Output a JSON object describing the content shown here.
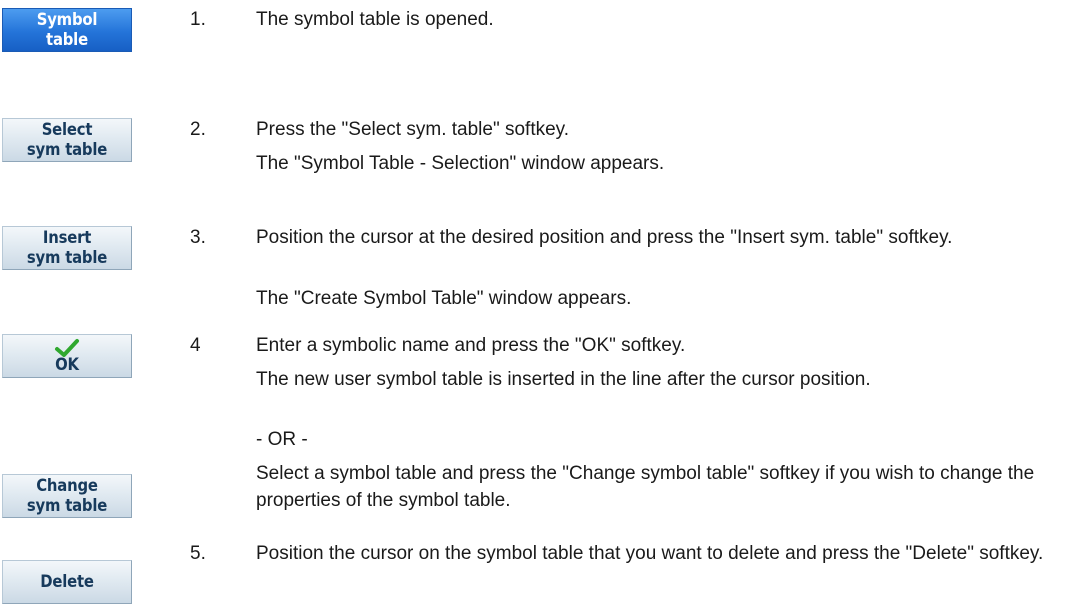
{
  "softkeys": {
    "symbol_table": [
      "Symbol",
      "table"
    ],
    "select_sym_table": [
      "Select",
      "sym table"
    ],
    "insert_sym_table": [
      "Insert",
      "sym table"
    ],
    "ok": "OK",
    "change_sym_table": [
      "Change",
      "sym table"
    ],
    "delete": "Delete"
  },
  "steps": [
    {
      "number": "1.",
      "lines": [
        "The symbol table is opened."
      ]
    },
    {
      "number": "2.",
      "lines": [
        "Press the \"Select sym. table\" softkey.",
        "The \"Symbol Table - Selection\" window appears."
      ]
    },
    {
      "number": "3.",
      "lines": [
        "Position the cursor at the desired position and press the \"Insert sym. table\" softkey.",
        "The \"Create Symbol Table\" window appears."
      ]
    },
    {
      "number": "4",
      "lines": [
        "Enter a symbolic name and press the \"OK\" softkey.",
        "The new user symbol table is inserted in the line after the cursor position.",
        "- OR -",
        "Select a symbol table and press the \"Change symbol table\" softkey if you wish to change the properties of the symbol table."
      ]
    },
    {
      "number": "5.",
      "lines": [
        "Position the cursor on the symbol table that you want to delete and press the \"Delete\" softkey."
      ]
    }
  ],
  "colors": {
    "active_softkey": "#2474d9",
    "softkey": "#dde7ef",
    "ok_check": "#2fa82f"
  }
}
